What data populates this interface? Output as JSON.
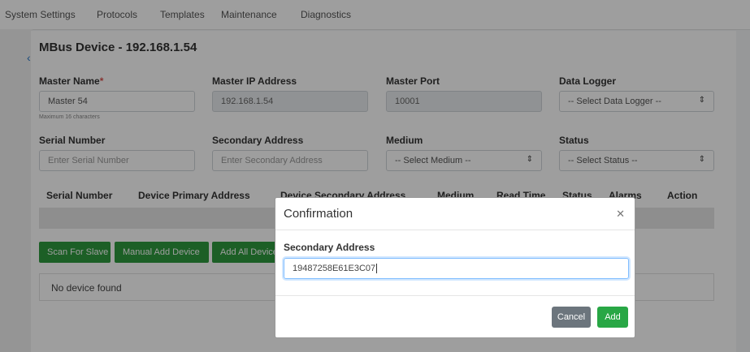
{
  "nav": {
    "tabs": [
      "System Settings",
      "Protocols",
      "Templates",
      "Maintenance",
      "Diagnostics"
    ]
  },
  "page": {
    "back_icon": "chevron-left-icon",
    "title": "MBus Device - 192.168.1.54",
    "master_name": {
      "label": "Master Name",
      "required_mark": "*",
      "value": "Master 54",
      "hint": "Maximum 16 characters"
    },
    "master_ip": {
      "label": "Master IP Address",
      "value": "192.168.1.54"
    },
    "master_port": {
      "label": "Master Port",
      "value": "10001"
    },
    "data_logger": {
      "label": "Data Logger",
      "value": "-- Select Data Logger --"
    },
    "serial_number": {
      "label": "Serial Number",
      "placeholder": "Enter Serial Number"
    },
    "secondary_address": {
      "label": "Secondary Address",
      "placeholder": "Enter Secondary Address"
    },
    "medium": {
      "label": "Medium",
      "value": "-- Select Medium --"
    },
    "status": {
      "label": "Status",
      "value": "-- Select Status --"
    },
    "table_headers": [
      "Serial Number",
      "Device Primary Address",
      "Device Secondary Address",
      "Medium",
      "Read Time",
      "Status",
      "Alarms",
      "Action"
    ],
    "buttons": {
      "scan": "Scan For Slave",
      "manual_add": "Manual Add Device",
      "add_all": "Add All Devices"
    },
    "empty_message": "No device found"
  },
  "modal": {
    "title": "Confirmation",
    "close_icon": "close-icon",
    "field_label": "Secondary Address",
    "field_value": "19487258E61E3C07",
    "cancel_label": "Cancel",
    "add_label": "Add"
  },
  "colors": {
    "primary_green": "#28a745",
    "scan_green": "#2e9a3e",
    "cancel_gray": "#6c757d",
    "required_red": "#d9534f",
    "link_blue": "#2a78c8"
  }
}
